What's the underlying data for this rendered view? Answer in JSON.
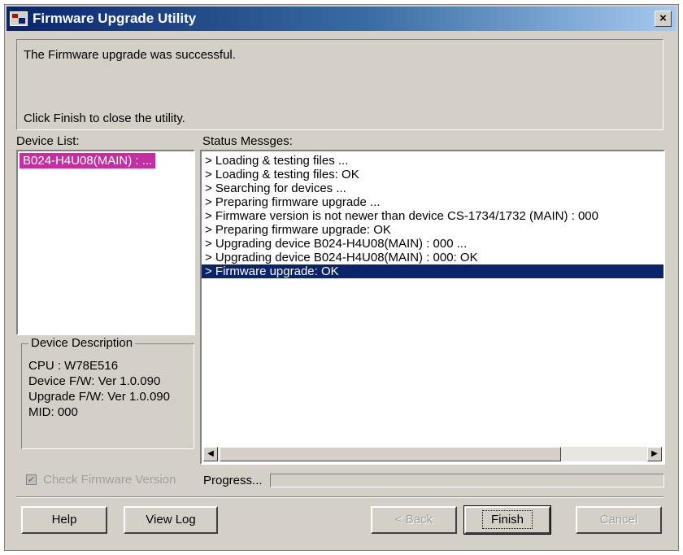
{
  "window": {
    "title": "Firmware Upgrade Utility",
    "close_glyph": "×"
  },
  "info": {
    "line1": "The Firmware upgrade was successful.",
    "line2": "Click Finish to close the utility."
  },
  "device_list": {
    "label": "Device List:",
    "items": [
      "B024-H4U08(MAIN) : ..."
    ]
  },
  "device_description": {
    "title": "Device Description",
    "lines": [
      "CPU : W78E516",
      "Device F/W: Ver 1.0.090",
      "Upgrade F/W: Ver 1.0.090",
      "MID: 000"
    ]
  },
  "status": {
    "label": "Status Messges:",
    "messages": [
      "> Loading & testing files ...",
      "> Loading & testing files: OK",
      "> Searching for devices ...",
      "> Preparing firmware upgrade ...",
      "> Firmware version is not newer than device CS-1734/1732 (MAIN) : 000",
      "> Preparing firmware upgrade: OK",
      "> Upgrading device B024-H4U08(MAIN) : 000 ...",
      "> Upgrading device B024-H4U08(MAIN) : 000: OK",
      "> Firmware upgrade: OK"
    ],
    "selected_index": 8
  },
  "check_firmware": {
    "label": "Check Firmware Version",
    "checked": true,
    "enabled": false
  },
  "progress": {
    "label": "Progress...",
    "value": 0
  },
  "buttons": {
    "help": "Help",
    "view_log": "View Log",
    "back": "< Back",
    "finish": "Finish",
    "cancel": "Cancel"
  }
}
